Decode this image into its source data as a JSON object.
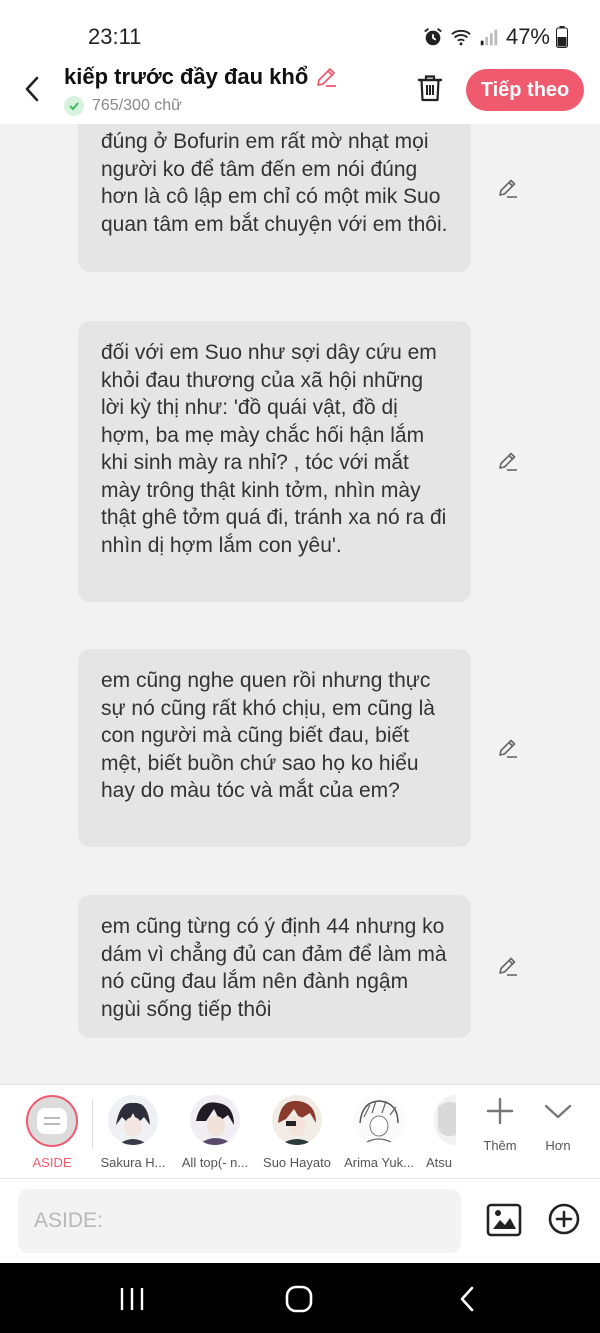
{
  "status_bar": {
    "time": "23:11",
    "battery": "47%",
    "icons": [
      "alarm-icon",
      "wifi-icon",
      "signal-icon",
      "battery-icon"
    ]
  },
  "header": {
    "title": "kiếp trước đầy đau khổ",
    "word_count": "765/300 chữ",
    "next_label": "Tiếp theo",
    "accent_color": "#ef5a6f"
  },
  "messages": [
    {
      "text": "đúng ở Bofurin em rất mờ nhạt mọi người ko để tâm đến em nói đúng hơn là cô lập em chỉ có một mik Suo quan tâm em bắt chuyện với em thôi."
    },
    {
      "text": "đối với em Suo như sợi dây cứu em khỏi đau thương của xã hội những lời kỳ thị như: 'đồ quái vật, đồ dị hợm, ba mẹ mày chắc hối hận lắm khi sinh mày ra nhỉ? , tóc với mắt mày trông thật kinh tởm, nhìn mày thật ghê tởm quá đi, tránh xa nó ra đi nhìn dị hợm lắm con yêu'."
    },
    {
      "text": "em cũng nghe quen rồi nhưng thực sự nó cũng rất khó chịu, em cũng là con người mà cũng biết đau, biết mệt, biết buồn chứ sao họ ko hiểu hay do màu tóc và mắt của em?"
    },
    {
      "text": "em cũng từng có ý định 44 nhưng ko dám vì chẳng đủ can đảm để làm mà nó cũng đau lắm nên đành ngậm ngùi sống tiếp thôi"
    }
  ],
  "characters": {
    "aside_label": "ASIDE",
    "items": [
      {
        "label": "Sakura H..."
      },
      {
        "label": "All top(- n..."
      },
      {
        "label": "Suo Hayato"
      },
      {
        "label": "Arima Yuk..."
      },
      {
        "label": "Atsu"
      }
    ],
    "add_label": "Thêm",
    "more_label": "Hơn"
  },
  "composer": {
    "placeholder": "ASIDE:"
  }
}
